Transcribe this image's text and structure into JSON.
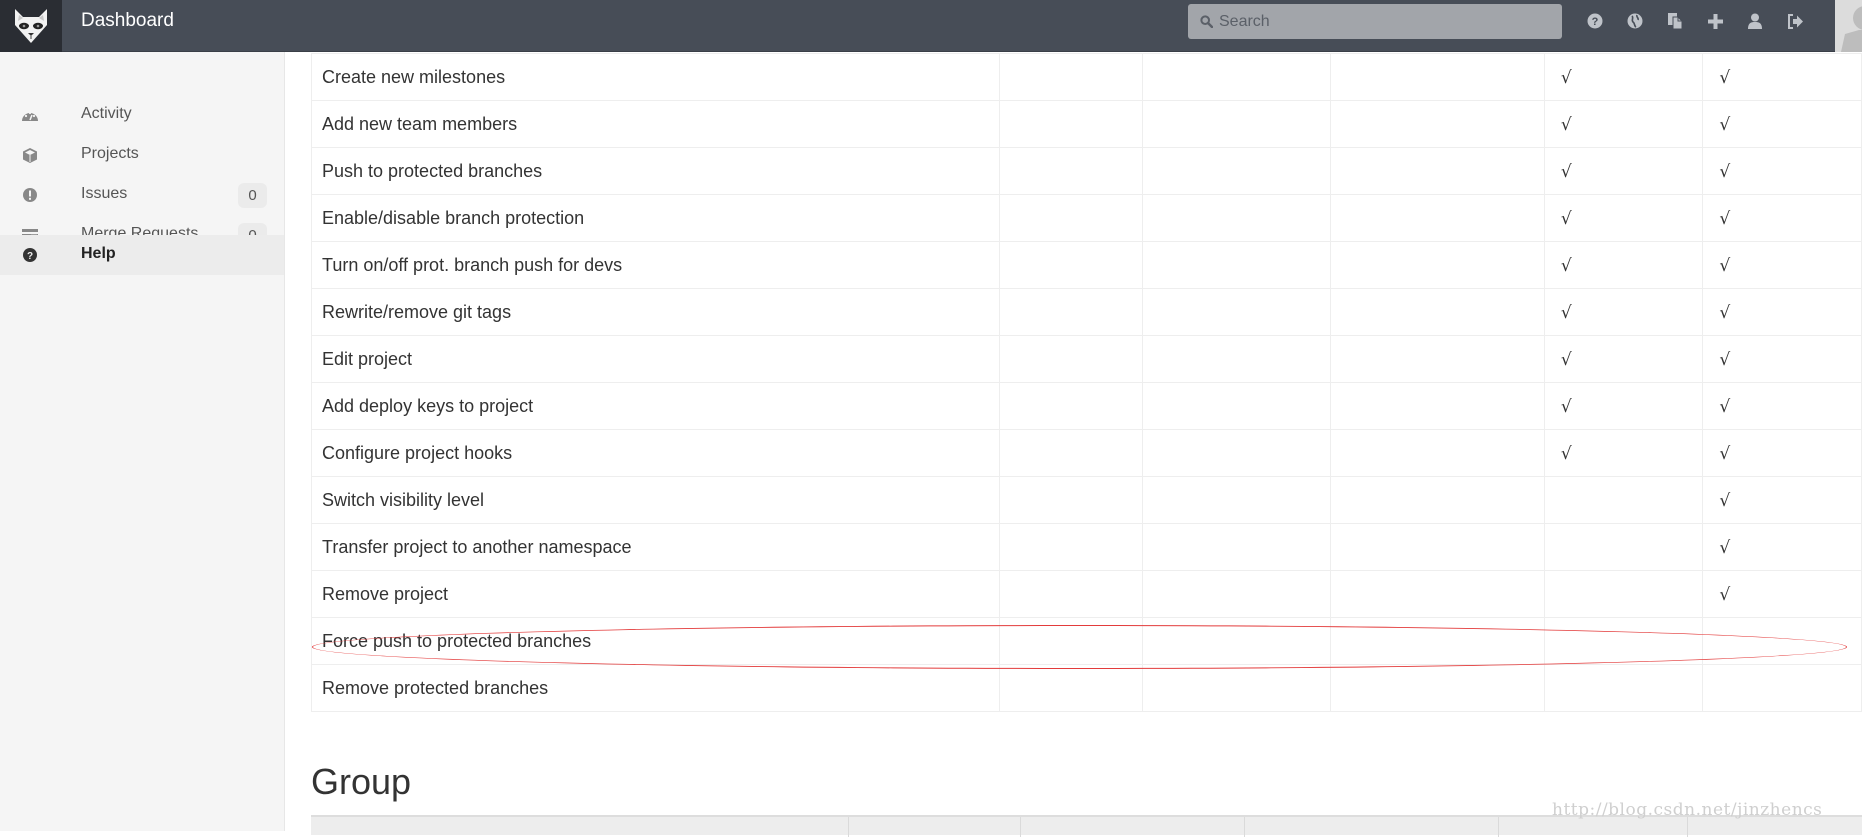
{
  "header": {
    "app_title": "Dashboard",
    "search_placeholder": "Search",
    "icons": [
      "help-icon",
      "explore-globe-icon",
      "snippets-icon",
      "new-project-plus-icon",
      "profile-user-icon",
      "sign-out-icon"
    ]
  },
  "sidebar": {
    "items": [
      {
        "label": "Activity",
        "icon": "dashboard-gauge-icon",
        "badge": null,
        "active": false
      },
      {
        "label": "Projects",
        "icon": "cube-icon",
        "badge": null,
        "active": false
      },
      {
        "label": "Issues",
        "icon": "exclamation-circle-icon",
        "badge": "0",
        "active": false
      },
      {
        "label": "Merge Requests",
        "icon": "tasks-icon",
        "badge": "0",
        "active": false
      },
      {
        "label": "Help",
        "icon": "question-circle-icon",
        "badge": null,
        "active": true
      }
    ]
  },
  "permissions_table": {
    "check_symbol": "√",
    "rows": [
      {
        "action": "Create new milestones",
        "checks": [
          false,
          false,
          false,
          true,
          true
        ]
      },
      {
        "action": "Add new team members",
        "checks": [
          false,
          false,
          false,
          true,
          true
        ]
      },
      {
        "action": "Push to protected branches",
        "checks": [
          false,
          false,
          false,
          true,
          true
        ]
      },
      {
        "action": "Enable/disable branch protection",
        "checks": [
          false,
          false,
          false,
          true,
          true
        ]
      },
      {
        "action": "Turn on/off prot. branch push for devs",
        "checks": [
          false,
          false,
          false,
          true,
          true
        ]
      },
      {
        "action": "Rewrite/remove git tags",
        "checks": [
          false,
          false,
          false,
          true,
          true
        ]
      },
      {
        "action": "Edit project",
        "checks": [
          false,
          false,
          false,
          true,
          true
        ]
      },
      {
        "action": "Add deploy keys to project",
        "checks": [
          false,
          false,
          false,
          true,
          true
        ]
      },
      {
        "action": "Configure project hooks",
        "checks": [
          false,
          false,
          false,
          true,
          true
        ]
      },
      {
        "action": "Switch visibility level",
        "checks": [
          false,
          false,
          false,
          false,
          true
        ]
      },
      {
        "action": "Transfer project to another namespace",
        "checks": [
          false,
          false,
          false,
          false,
          true
        ]
      },
      {
        "action": "Remove project",
        "checks": [
          false,
          false,
          false,
          false,
          true
        ]
      },
      {
        "action": "Force push to protected branches",
        "checks": [
          false,
          false,
          false,
          false,
          false
        ],
        "highlighted": true
      },
      {
        "action": "Remove protected branches",
        "checks": [
          false,
          false,
          false,
          false,
          false
        ]
      }
    ]
  },
  "group_section": {
    "title": "Group"
  },
  "watermark": "http://blog.csdn.net/jinzhencs",
  "colors": {
    "header_bg": "#474d57",
    "logo_bg": "#2a2d33",
    "sidebar_bg": "#f5f5f5",
    "highlight_ellipse": "#e33b3b"
  }
}
